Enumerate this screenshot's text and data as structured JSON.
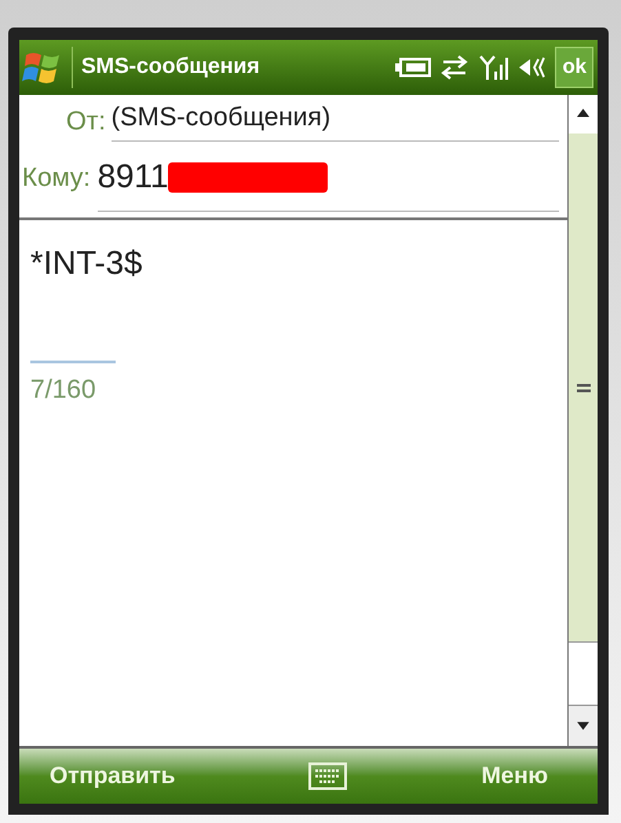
{
  "title_bar": {
    "title": "SMS-сообщения",
    "ok": "ok"
  },
  "from": {
    "label": "От:",
    "value": "(SMS-сообщения)"
  },
  "to": {
    "label": "Кому:",
    "value": "8911",
    "redacted": true
  },
  "message": {
    "text": "*INT-3$",
    "counter": "7/160"
  },
  "softkeys": {
    "left": "Отправить",
    "right": "Меню"
  }
}
